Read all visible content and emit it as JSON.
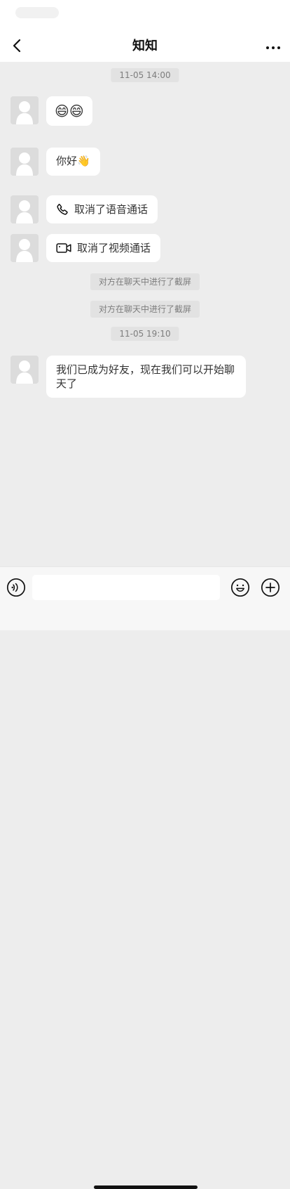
{
  "header": {
    "title": "知知",
    "back_icon": "chevron-left-icon",
    "more_icon": "more-horizontal-icon"
  },
  "timestamps": [
    "11-05 14:00",
    "11-05 19:10"
  ],
  "messages": [
    {
      "type": "emoji",
      "text": "😄😄"
    },
    {
      "type": "text",
      "text": "你好👋"
    },
    {
      "type": "call",
      "text": "取消了语音通话",
      "icon": "phone-icon"
    },
    {
      "type": "call",
      "text": "取消了视频通话",
      "icon": "video-icon"
    }
  ],
  "system_notes": [
    "对方在聊天中进行了截屏",
    "对方在聊天中进行了截屏"
  ],
  "final_message": "我们已成为好友，现在我们可以开始聊天了",
  "input": {
    "value": "",
    "voice_icon": "voice-icon",
    "emoji_icon": "emoji-icon",
    "plus_icon": "plus-icon"
  },
  "colors": {
    "background": "#ededed",
    "bubble": "#ffffff",
    "text": "#333333",
    "muted": "#7d7d7d"
  }
}
